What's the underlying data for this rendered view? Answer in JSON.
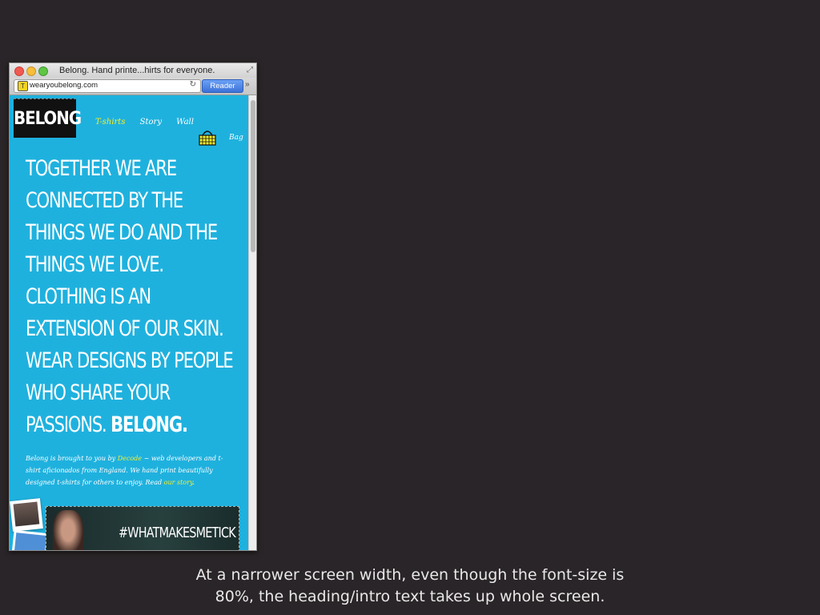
{
  "browser": {
    "title": "Belong. Hand printe...hirts for everyone.",
    "url": "wearyoubelong.com",
    "reader_label": "Reader"
  },
  "site": {
    "logo": "BELONG",
    "nav": [
      "T-shirts",
      "Story",
      "Wall"
    ],
    "bag_label": "Bag",
    "heading_lines": [
      "Together we are",
      "connected by the",
      "things we do and the",
      "things we love.",
      "Clothing is an",
      "extension of our skin.",
      "Wear designs by people",
      "who share your"
    ],
    "heading_last_prefix": "passions. ",
    "heading_last_strong": "Belong.",
    "intro": {
      "part1": "Belong is brought to you by ",
      "link1": "Decode",
      "part2": " ~ web developers and t-shirt aficionados from England. We hand print beautifully designed t-shirts for others to enjoy. Read ",
      "link2": "our story",
      "part3": "."
    },
    "banner_tag": "#WHATMAKESMETICK"
  },
  "caption": {
    "line1": "At a narrower screen width, even though the font-size is",
    "line2": "80%, the heading/intro text takes up whole screen."
  },
  "colors": {
    "page_bg": "#2a2528",
    "site_bg": "#1fb1de",
    "accent": "#f4ee2c"
  }
}
